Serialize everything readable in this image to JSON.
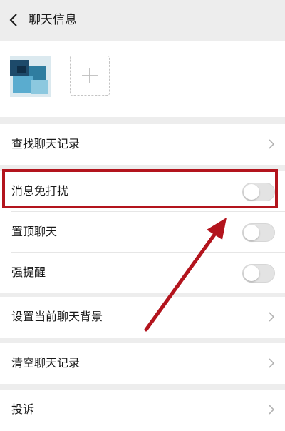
{
  "header": {
    "back_icon": "chevron-left-icon",
    "title": "聊天信息"
  },
  "members": {
    "avatar_icon": "group-avatar",
    "add_icon": "plus-icon"
  },
  "rows": {
    "search_history": "查找聊天记录",
    "mute_notifications": "消息免打扰",
    "pin_chat": "置顶聊天",
    "strong_alert": "强提醒",
    "set_background": "设置当前聊天背景",
    "clear_history": "清空聊天记录",
    "report": "投诉"
  },
  "toggles": {
    "mute_notifications": false,
    "pin_chat": false,
    "strong_alert": false
  },
  "colors": {
    "highlight": "#b3141d",
    "background": "#ededed",
    "row": "#ffffff"
  }
}
